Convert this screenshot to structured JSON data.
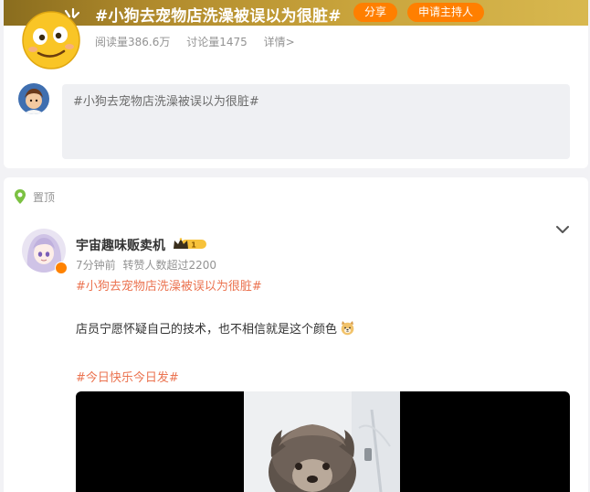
{
  "topic": {
    "title": "#小狗去宠物店洗澡被误以为很脏#",
    "share_label": "分享",
    "host_label": "申请主持人",
    "reads": "阅读量386.6万",
    "discussions": "讨论量1475",
    "details": "详情>",
    "brand_gold": "#c9a43c",
    "accent_orange": "#ff7f00"
  },
  "composer": {
    "placeholder": "#小狗去宠物店洗澡被误以为很脏#"
  },
  "post": {
    "pinned_label": "置顶",
    "author": "宇宙趣味贩卖机",
    "meta_time": "7分钟前",
    "meta_reposts": "转赞人数超过2200",
    "hashtag_1": "#小狗去宠物店洗澡被误以为很脏#",
    "text": "店员宁愿怀疑自己的技术，也不相信就是这个颜色",
    "hashtag_2": "#今日快乐今日发#",
    "hashtag_color": "#eb7350"
  },
  "icons": {
    "topic": "smiley-emoji-icon",
    "pin": "location-pin-icon",
    "expand": "chevron-down-icon",
    "vip": "crown-badge-icon",
    "emoji": "dog-face-emoji-icon"
  }
}
